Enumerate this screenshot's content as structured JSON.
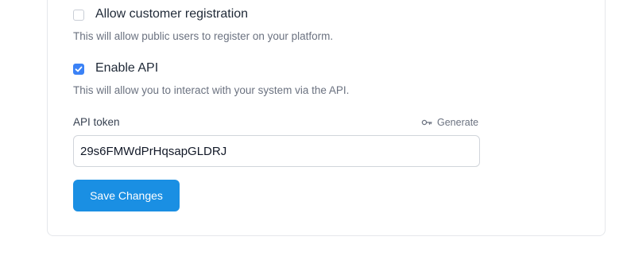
{
  "settings": {
    "customer_registration": {
      "label": "Allow customer registration",
      "description": "This will allow public users to register on your platform.",
      "checked": false
    },
    "enable_api": {
      "label": "Enable API",
      "description": "This will allow you to interact with your system via the API.",
      "checked": true
    },
    "api_token": {
      "label": "API token",
      "value": "29s6FMWdPrHqsapGLDRJ",
      "generate_label": "Generate",
      "generate_icon": "key-icon"
    },
    "save_label": "Save Changes"
  },
  "colors": {
    "accent": "#3b82f6",
    "button": "#1a8fe3",
    "muted_text": "#6b7280",
    "border": "#e5e7eb"
  }
}
